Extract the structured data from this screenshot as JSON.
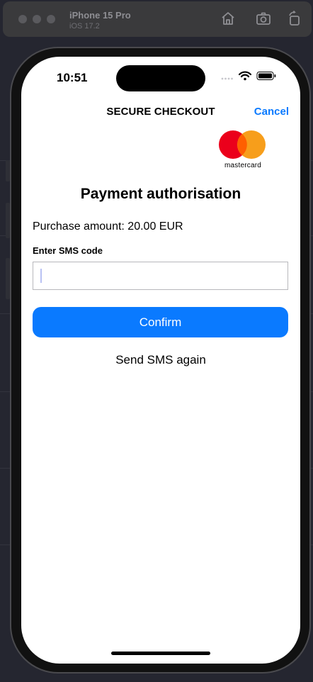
{
  "simulator": {
    "device_name": "iPhone 15 Pro",
    "os_version": "iOS 17.2",
    "icons": [
      "home-icon",
      "screenshot-icon",
      "rotate-icon"
    ]
  },
  "status_bar": {
    "time": "10:51",
    "icons": [
      "cellular-icon",
      "wifi-icon",
      "battery-icon"
    ]
  },
  "header": {
    "title": "SECURE CHECKOUT",
    "cancel_label": "Cancel"
  },
  "brand": {
    "logo_text": "mastercard",
    "colors": {
      "red": "#eb001b",
      "orange": "#f79e1b",
      "overlap": "#ff5f00"
    }
  },
  "main": {
    "heading": "Payment authorisation",
    "amount_text": "Purchase amount: 20.00 EUR",
    "sms_label": "Enter SMS code",
    "sms_value": "",
    "confirm_label": "Confirm",
    "resend_label": "Send SMS again"
  },
  "colors": {
    "accent": "#0a7aff",
    "background": "#ffffff"
  }
}
